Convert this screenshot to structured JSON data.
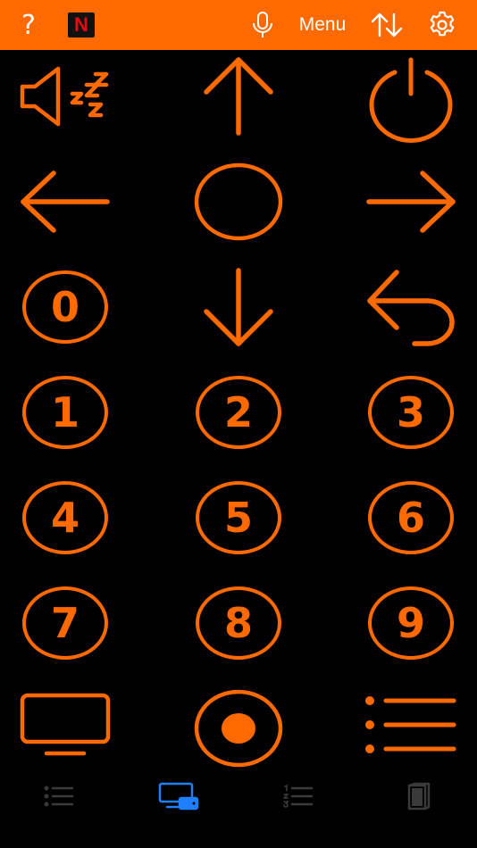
{
  "toolbar": {
    "help_label": "?",
    "netflix_label": "N",
    "menu_label": "Menu",
    "icons": [
      "help-icon",
      "netflix-icon",
      "microphone-icon",
      "sort-icon",
      "gear-icon"
    ]
  },
  "remote": {
    "digits": [
      "0",
      "1",
      "2",
      "3",
      "4",
      "5",
      "6",
      "7",
      "8",
      "9"
    ],
    "buttons": [
      "sleep",
      "up",
      "power",
      "left",
      "ok",
      "right",
      "0",
      "down",
      "back",
      "1",
      "2",
      "3",
      "4",
      "5",
      "6",
      "7",
      "8",
      "9",
      "tv",
      "record",
      "list"
    ]
  },
  "tabs": {
    "items": [
      "channels-list-tab",
      "remote-tab",
      "numbered-list-tab",
      "guide-tab"
    ],
    "active": "remote-tab"
  },
  "colors": {
    "accent": "#FF6A00",
    "background": "#000000",
    "tab_active": "#1E7FFF",
    "tab_inactive": "#3A3A3A",
    "netflix_red": "#E50914"
  }
}
